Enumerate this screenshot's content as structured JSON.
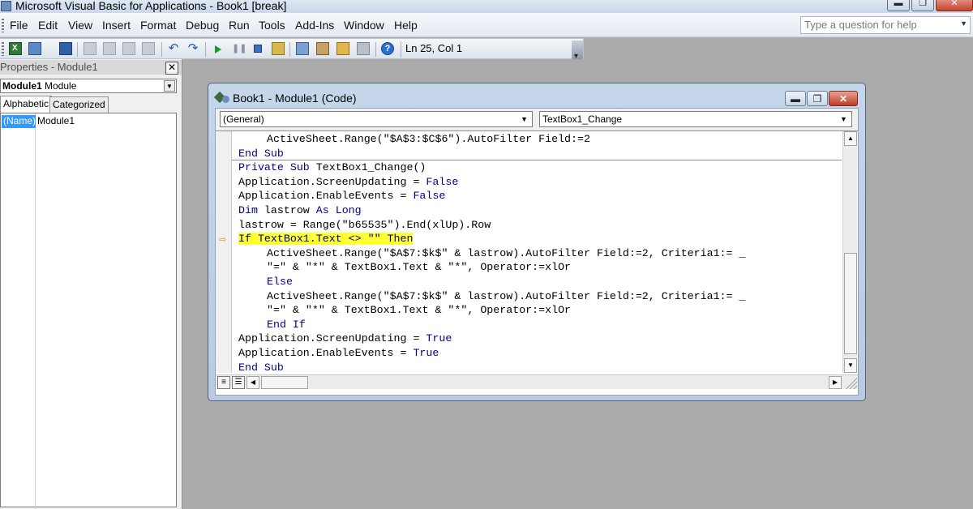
{
  "window": {
    "title": "Microsoft Visual Basic for Applications - Book1 [break]",
    "minimize_glyph": "▬",
    "restore_glyph": "❐",
    "close_glyph": "✕"
  },
  "menu": {
    "items": [
      "File",
      "Edit",
      "View",
      "Insert",
      "Format",
      "Debug",
      "Run",
      "Tools",
      "Add-Ins",
      "Window",
      "Help"
    ],
    "help_placeholder": "Type a question for help"
  },
  "toolbar": {
    "position_text": "Ln 25, Col 1",
    "help_glyph": "?"
  },
  "properties": {
    "title": "Properties - Module1",
    "close_glyph": "✕",
    "object_name": "Module1",
    "object_type": "Module",
    "tabs": [
      "Alphabetic",
      "Categorized"
    ],
    "active_tab": "Alphabetic",
    "rows": [
      {
        "name": "(Name)",
        "value": "Module1"
      }
    ]
  },
  "code_window": {
    "title": "Book1 - Module1 (Code)",
    "object_combo": "(General)",
    "procedure_combo": "TextBox1_Change",
    "lines": [
      {
        "indent": 1,
        "kw": "",
        "text": "ActiveSheet.Range(\"$A$3:$C$6\").AutoFilter Field:=2"
      },
      {
        "indent": 0,
        "kw": "End Sub",
        "text": ""
      },
      {
        "indent": 0,
        "kw": "Private Sub",
        "text": " TextBox1_Change()"
      },
      {
        "indent": 0,
        "kw": "",
        "text": "Application.ScreenUpdating = ",
        "kw2": "False"
      },
      {
        "indent": 0,
        "kw": "",
        "text": "Application.EnableEvents = ",
        "kw2": "False"
      },
      {
        "indent": 0,
        "kw": "Dim",
        "text": " lastrow ",
        "kw2": "As Long"
      },
      {
        "indent": 0,
        "kw": "",
        "text": "lastrow = Range(\"b65535\").End(xlUp).Row"
      },
      {
        "indent": 0,
        "kw": "",
        "text": "If TextBox1.Text <> \"\" Then",
        "highlight": true
      },
      {
        "indent": 1,
        "kw": "",
        "text": "ActiveSheet.Range(\"$A$7:$k$\" & lastrow).AutoFilter Field:=2, Criteria1:= _"
      },
      {
        "indent": 1,
        "kw": "",
        "text": "\"=\" & \"*\" & TextBox1.Text & \"*\", Operator:=xlOr"
      },
      {
        "indent": 1,
        "kw": "Else",
        "text": ""
      },
      {
        "indent": 1,
        "kw": "",
        "text": "ActiveSheet.Range(\"$A$7:$k$\" & lastrow).AutoFilter Field:=2, Criteria1:= _"
      },
      {
        "indent": 1,
        "kw": "",
        "text": "\"=\" & \"*\" & TextBox1.Text & \"*\", Operator:=xlOr"
      },
      {
        "indent": 1,
        "kw": "End If",
        "text": ""
      },
      {
        "indent": 0,
        "kw": "",
        "text": "Application.ScreenUpdating = ",
        "kw2": "True"
      },
      {
        "indent": 0,
        "kw": "",
        "text": "Application.EnableEvents = ",
        "kw2": "True"
      },
      {
        "indent": 0,
        "kw": "End Sub",
        "text": ""
      }
    ]
  },
  "colors": {
    "keyword": "#00008b",
    "highlight": "#ffff33",
    "selection": "#3399ff"
  },
  "icons": {
    "execution_arrow": "⇨",
    "dropdown": "▼",
    "scroll_up": "▲",
    "scroll_down": "▼",
    "scroll_left": "◀",
    "scroll_right": "▶",
    "procedure_view": "≡",
    "full_module_view": "☰"
  }
}
